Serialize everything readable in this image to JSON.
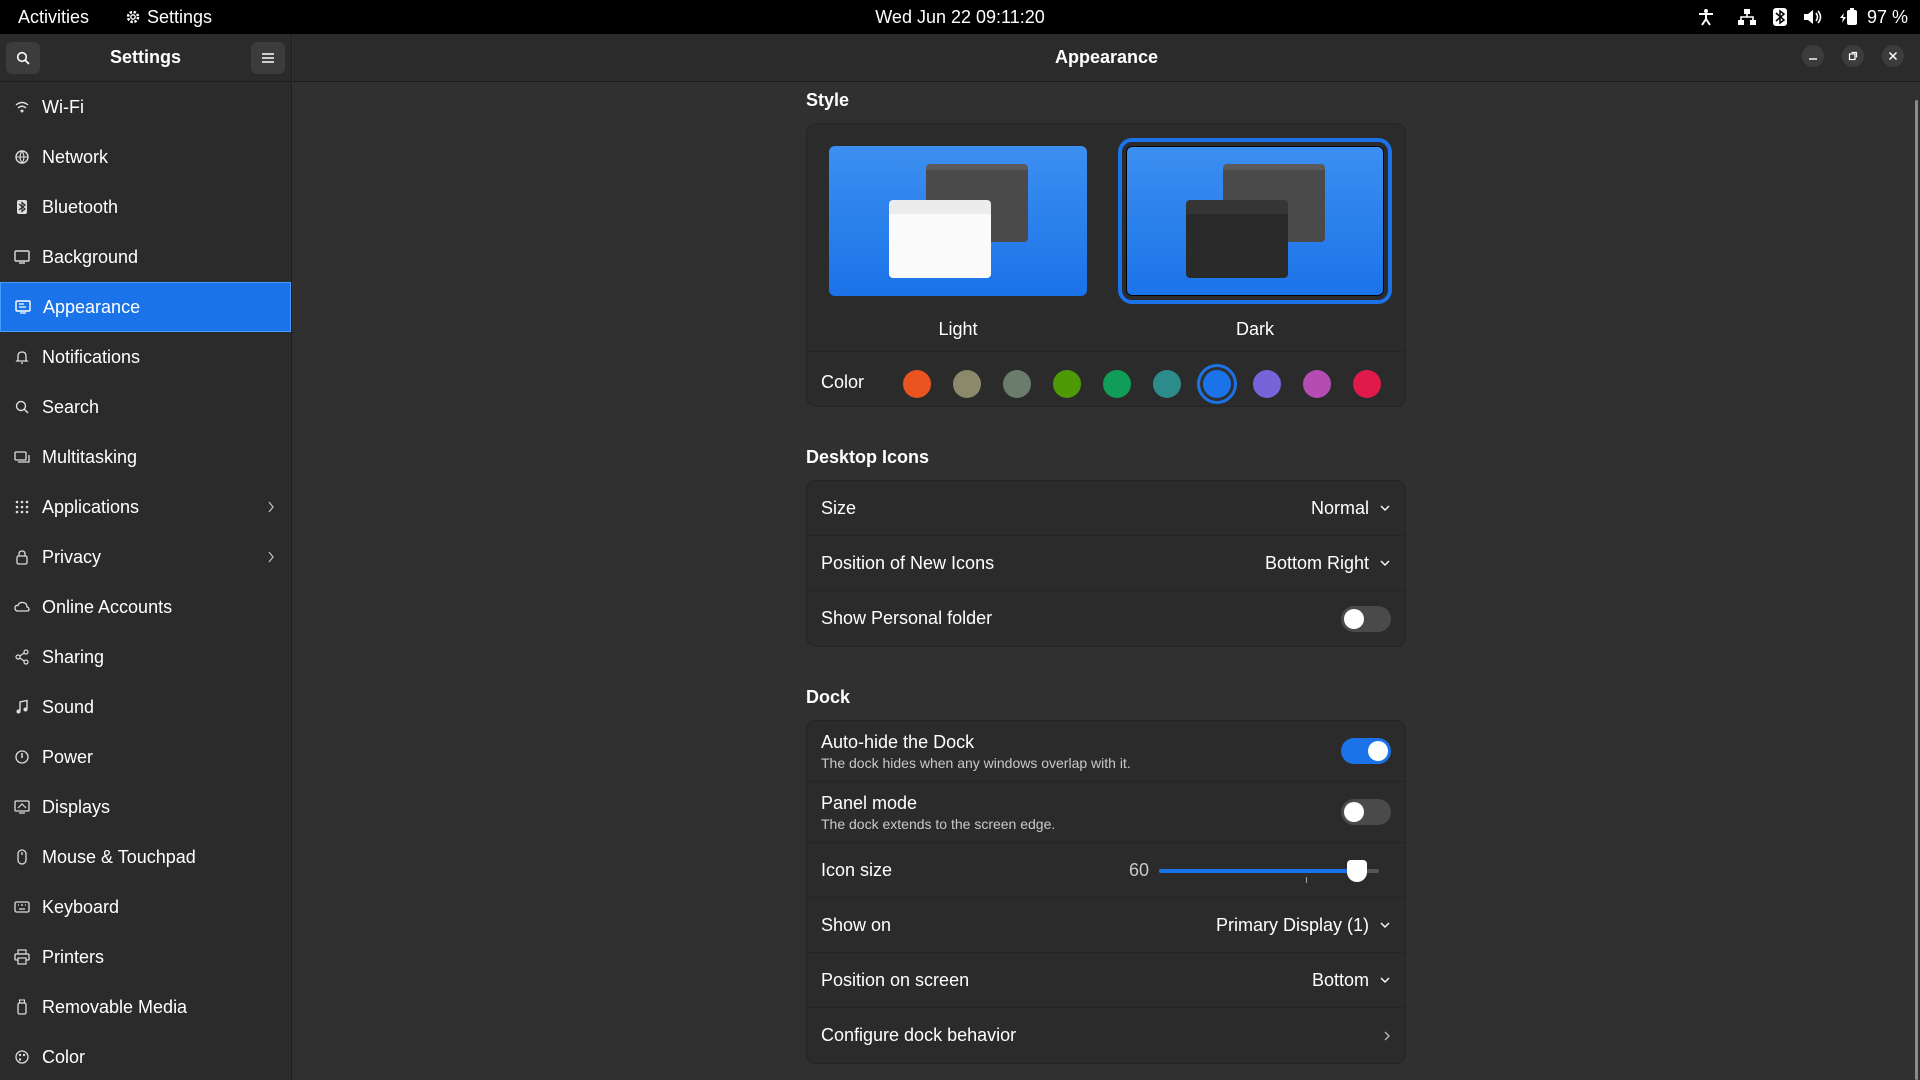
{
  "topbar": {
    "activities": "Activities",
    "app_name": "Settings",
    "clock": "Wed Jun 22  09:11:20",
    "battery": "97 %"
  },
  "sidebar": {
    "title": "Settings",
    "items": [
      {
        "label": "Wi-Fi",
        "icon": "wifi-icon"
      },
      {
        "label": "Network",
        "icon": "network-icon"
      },
      {
        "label": "Bluetooth",
        "icon": "bluetooth-icon"
      },
      {
        "label": "Background",
        "icon": "background-icon"
      },
      {
        "label": "Appearance",
        "icon": "appearance-icon",
        "active": true
      },
      {
        "label": "Notifications",
        "icon": "bell-icon"
      },
      {
        "label": "Search",
        "icon": "search-icon"
      },
      {
        "label": "Multitasking",
        "icon": "multitasking-icon"
      },
      {
        "label": "Applications",
        "icon": "apps-grid-icon",
        "chevron": true
      },
      {
        "label": "Privacy",
        "icon": "lock-icon",
        "chevron": true
      },
      {
        "label": "Online Accounts",
        "icon": "cloud-icon"
      },
      {
        "label": "Sharing",
        "icon": "share-icon"
      },
      {
        "label": "Sound",
        "icon": "music-note-icon"
      },
      {
        "label": "Power",
        "icon": "power-icon"
      },
      {
        "label": "Displays",
        "icon": "display-icon"
      },
      {
        "label": "Mouse & Touchpad",
        "icon": "mouse-icon"
      },
      {
        "label": "Keyboard",
        "icon": "keyboard-icon"
      },
      {
        "label": "Printers",
        "icon": "printer-icon"
      },
      {
        "label": "Removable Media",
        "icon": "usb-icon"
      },
      {
        "label": "Color",
        "icon": "color-icon"
      }
    ]
  },
  "header": {
    "title": "Appearance"
  },
  "style": {
    "title": "Style",
    "light_label": "Light",
    "dark_label": "Dark",
    "selected": "Dark",
    "color_label": "Color",
    "colors": [
      "#e95420",
      "#8a8a6a",
      "#6c7c6c",
      "#4e9a06",
      "#0f9d58",
      "#2c8c8c",
      "#1a73e8",
      "#7764d8",
      "#b34cb3",
      "#e01b4b"
    ],
    "selected_color": "#1a73e8"
  },
  "desktop_icons": {
    "title": "Desktop Icons",
    "size_label": "Size",
    "size_value": "Normal",
    "position_label": "Position of New Icons",
    "position_value": "Bottom Right",
    "personal_label": "Show Personal folder",
    "personal_on": false
  },
  "dock": {
    "title": "Dock",
    "autohide_label": "Auto-hide the Dock",
    "autohide_sub": "The dock hides when any windows overlap with it.",
    "autohide_on": true,
    "panel_label": "Panel mode",
    "panel_sub": "The dock extends to the screen edge.",
    "panel_on": false,
    "icon_size_label": "Icon size",
    "icon_size_value": "60",
    "icon_size_fraction": 0.9,
    "show_on_label": "Show on",
    "show_on_value": "Primary Display (1)",
    "position_label": "Position on screen",
    "position_value": "Bottom",
    "configure_label": "Configure dock behavior"
  }
}
